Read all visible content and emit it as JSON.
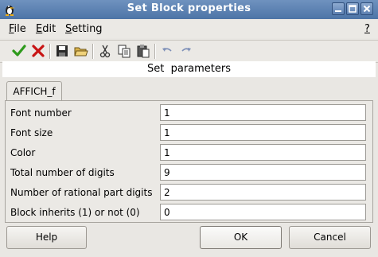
{
  "window": {
    "title": "Set Block properties",
    "controls": [
      "minimize",
      "maximize",
      "close"
    ]
  },
  "menubar": {
    "items": [
      {
        "label": "File",
        "mnemonic": "F",
        "rest": "ile"
      },
      {
        "label": "Edit",
        "mnemonic": "E",
        "rest": "dit"
      },
      {
        "label": "Setting",
        "mnemonic": "S",
        "rest": "etting"
      }
    ],
    "help": "?"
  },
  "toolbar": {
    "icons": [
      "ok-check-icon",
      "cancel-x-icon",
      "save-icon",
      "open-folder-icon",
      "cut-icon",
      "copy-icon",
      "paste-icon",
      "undo-icon",
      "redo-icon"
    ]
  },
  "header": {
    "text": "Set  parameters"
  },
  "tab": {
    "label": "AFFICH_f"
  },
  "fields": [
    {
      "label": "Font number",
      "value": "1"
    },
    {
      "label": "Font size",
      "value": "1"
    },
    {
      "label": "Color",
      "value": "1"
    },
    {
      "label": "Total number of digits",
      "value": "9"
    },
    {
      "label": "Number of rational part digits",
      "value": "2"
    },
    {
      "label": "Block inherits (1) or not (0)",
      "value": "0"
    }
  ],
  "buttons": {
    "help": "Help",
    "ok": "OK",
    "cancel": "Cancel"
  },
  "colors": {
    "titlebar": "#5a7fb0",
    "accept_green": "#2e9a1c",
    "reject_red": "#c81414"
  }
}
